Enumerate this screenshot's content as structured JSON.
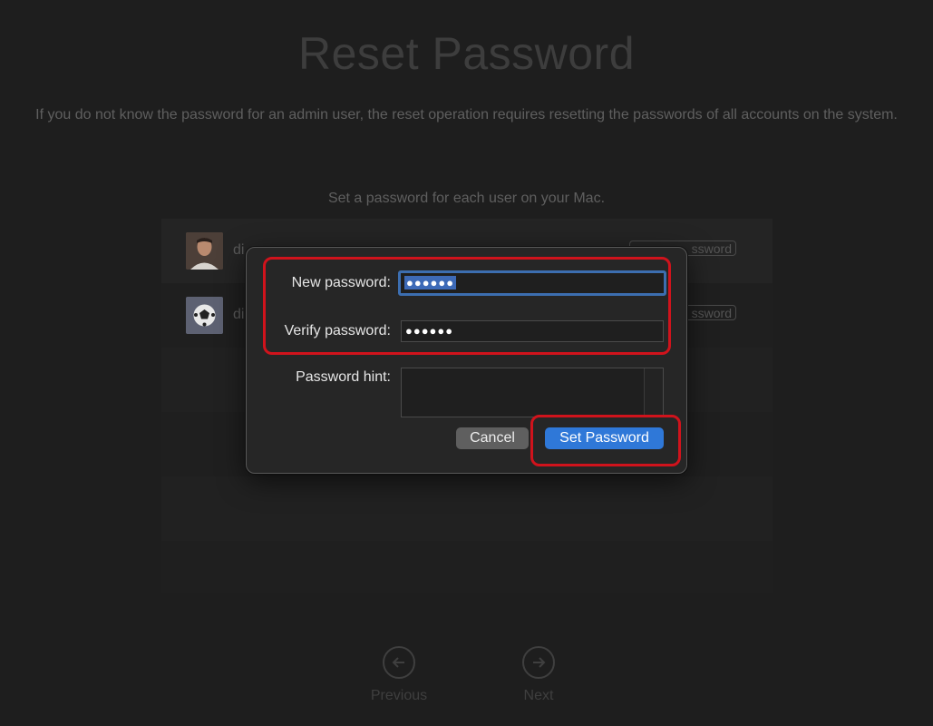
{
  "page": {
    "title": "Reset Password",
    "description": "If you do not know the password for an admin user, the reset operation requires resetting the passwords of all accounts on the system.",
    "subtitle": "Set a password for each user on your Mac."
  },
  "users": [
    {
      "name": "di",
      "button_label": "ssword",
      "avatar_icon": "person-photo-avatar"
    },
    {
      "name": "di",
      "button_label": "ssword",
      "avatar_icon": "soccer-ball-avatar"
    }
  ],
  "navigation": {
    "previous_label": "Previous",
    "next_label": "Next",
    "previous_icon": "arrow-left-circle-icon",
    "next_icon": "arrow-right-circle-icon"
  },
  "dialog": {
    "new_password_label": "New password:",
    "new_password_value": "●●●●●●",
    "verify_password_label": "Verify password:",
    "verify_password_value": "●●●●●●",
    "password_hint_label": "Password hint:",
    "password_hint_value": "",
    "cancel_label": "Cancel",
    "set_password_label": "Set Password"
  },
  "colors": {
    "background": "#1e1e1e",
    "accent": "#2f78d8",
    "highlight": "#d0131c",
    "dialog_bg": "#262626"
  }
}
